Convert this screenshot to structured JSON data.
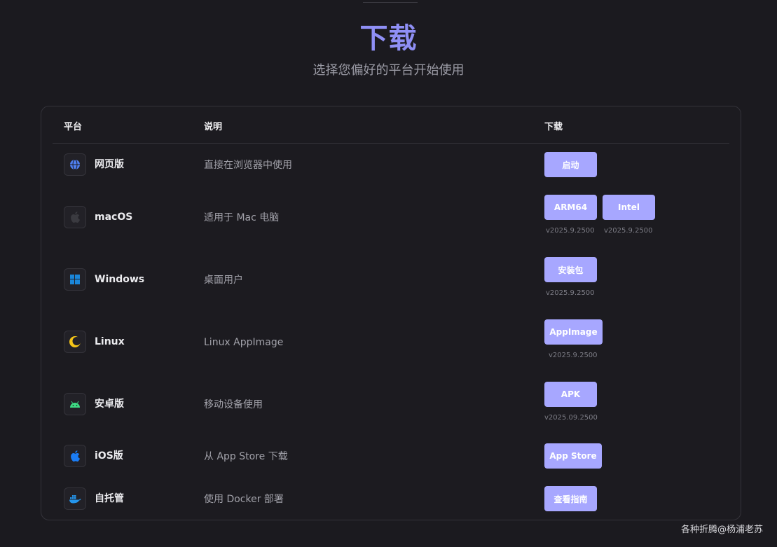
{
  "header": {
    "title": "下载",
    "subtitle": "选择您偏好的平台开始使用"
  },
  "table": {
    "columns": {
      "platform": "平台",
      "description": "说明",
      "download": "下载"
    },
    "rows": [
      {
        "icon": "globe-icon",
        "icon_color": "#4f7ff0",
        "name": "网页版",
        "desc": "直接在浏览器中使用",
        "buttons": [
          {
            "label": "启动"
          }
        ]
      },
      {
        "icon": "apple-icon",
        "icon_color": "#3a3a40",
        "name": "macOS",
        "desc": "适用于 Mac 电脑",
        "buttons": [
          {
            "label": "ARM64",
            "version": "v2025.9.2500"
          },
          {
            "label": "Intel",
            "version": "v2025.9.2500"
          }
        ]
      },
      {
        "icon": "windows-icon",
        "icon_color": "#1a86d9",
        "name": "Windows",
        "desc": "桌面用户",
        "buttons": [
          {
            "label": "安装包",
            "version": "v2025.9.2500"
          }
        ]
      },
      {
        "icon": "linux-moon-icon",
        "icon_color": "#f5c518",
        "name": "Linux",
        "desc": "Linux AppImage",
        "buttons": [
          {
            "label": "AppImage",
            "version": "v2025.9.2500"
          }
        ]
      },
      {
        "icon": "android-icon",
        "icon_color": "#3ddc84",
        "name": "安卓版",
        "desc": "移动设备使用",
        "buttons": [
          {
            "label": "APK",
            "version": "v2025.09.2500"
          }
        ]
      },
      {
        "icon": "apple-icon",
        "icon_color": "#1a7cf5",
        "name": "iOS版",
        "desc": "从 App Store 下载",
        "buttons": [
          {
            "label": "App Store"
          }
        ]
      },
      {
        "icon": "docker-icon",
        "icon_color": "#2496ed",
        "name": "自托管",
        "desc": "使用 Docker 部署",
        "buttons": [
          {
            "label": "查看指南"
          }
        ]
      }
    ]
  },
  "footer": {
    "watermark": "各种折腾@杨浦老苏"
  },
  "colors": {
    "accent": "#a7a7ff",
    "title": "#8f8ff5",
    "background": "#1b1a1f"
  }
}
